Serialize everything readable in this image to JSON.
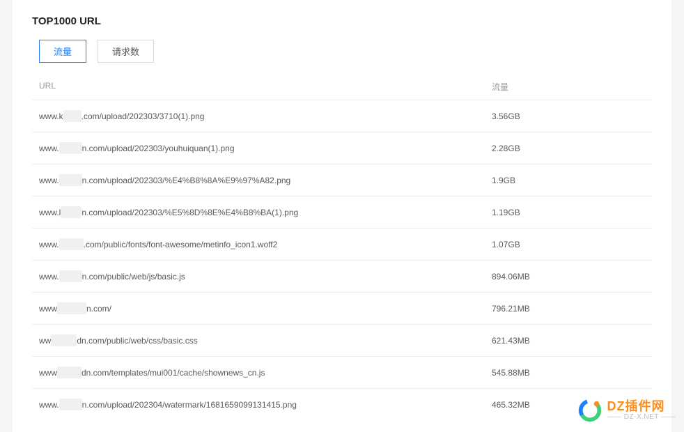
{
  "title": "TOP1000 URL",
  "tabs": [
    {
      "label": "流量",
      "active": true
    },
    {
      "label": "请求数",
      "active": false
    }
  ],
  "columns": {
    "url": "URL",
    "size": "流量"
  },
  "rows": [
    {
      "prefix": "www.k",
      "redact_width": 26,
      "suffix": ".com/upload/202303/3710(1).png",
      "size": "3.56GB"
    },
    {
      "prefix": "www.",
      "redact_width": 33,
      "suffix": "n.com/upload/202303/youhuiquan(1).png",
      "size": "2.28GB"
    },
    {
      "prefix": "www.",
      "redact_width": 33,
      "suffix": "n.com/upload/202303/%E4%B8%8A%E9%97%A82.png",
      "size": "1.9GB"
    },
    {
      "prefix": "www.l",
      "redact_width": 30,
      "suffix": "n.com/upload/202303/%E5%8D%8E%E4%B8%BA(1).png",
      "size": "1.19GB"
    },
    {
      "prefix": "www.",
      "redact_width": 35,
      "suffix": ".com/public/fonts/font-awesome/metinfo_icon1.woff2",
      "size": "1.07GB"
    },
    {
      "prefix": "www.",
      "redact_width": 33,
      "suffix": "n.com/public/web/js/basic.js",
      "size": "894.06MB"
    },
    {
      "prefix": "www",
      "redact_width": 42,
      "suffix": "n.com/",
      "size": "796.21MB"
    },
    {
      "prefix": "ww",
      "redact_width": 37,
      "suffix": "dn.com/public/web/css/basic.css",
      "size": "621.43MB"
    },
    {
      "prefix": "www",
      "redact_width": 35,
      "suffix": "dn.com/templates/mui001/cache/shownews_cn.js",
      "size": "545.88MB"
    },
    {
      "prefix": "www.",
      "redact_width": 33,
      "suffix": "n.com/upload/202304/watermark/1681659099131415.png",
      "size": "465.32MB"
    }
  ],
  "watermark": {
    "main": "DZ插件网",
    "sub": "DZ-X.NET"
  }
}
